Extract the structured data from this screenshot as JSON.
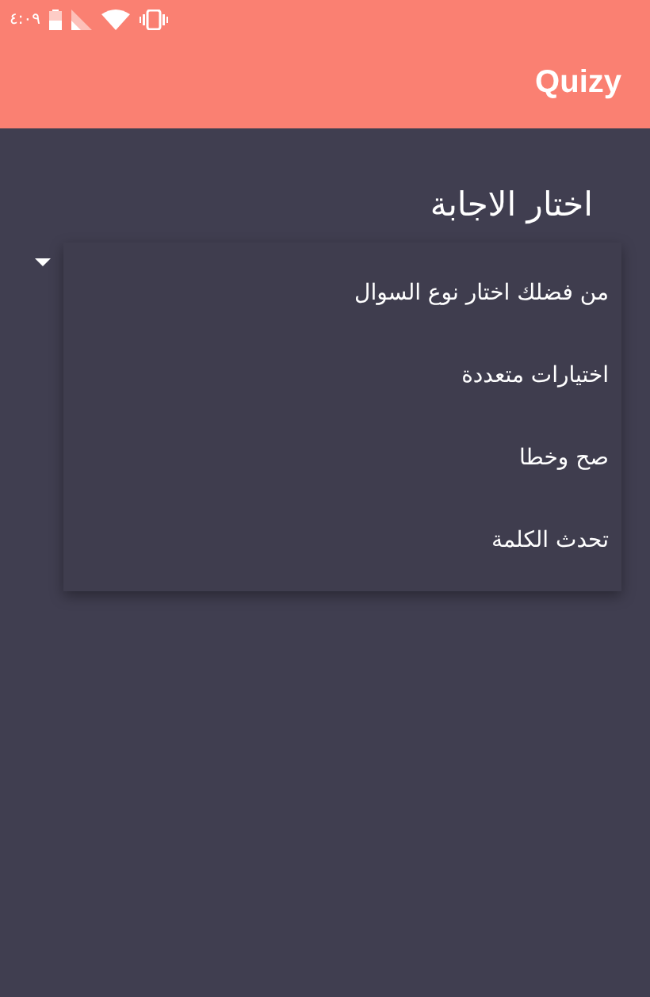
{
  "status_bar": {
    "time": "٤:٠٩"
  },
  "app_bar": {
    "title": "Quizy"
  },
  "heading": "اختار الاجابة",
  "dropdown_menu": {
    "items": [
      {
        "label": "من فضلك اختار نوع السوال",
        "selected": false
      },
      {
        "label": "اختيارات متعددة",
        "selected": false
      },
      {
        "label": "صح وخطا",
        "selected": false
      },
      {
        "label": "تحدث الكلمة",
        "selected": false
      }
    ]
  }
}
